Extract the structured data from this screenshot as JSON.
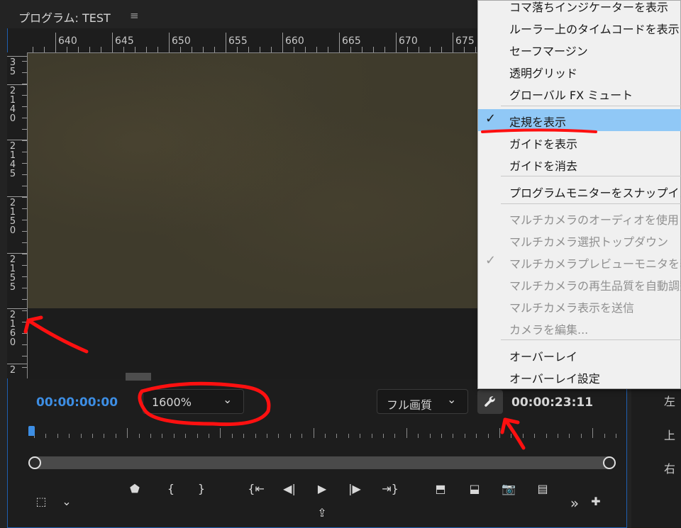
{
  "panel": {
    "title": "プログラム: TEST",
    "menu_icon": "≡"
  },
  "ruler": {
    "h_labels": [
      "640",
      "645",
      "650",
      "655",
      "660",
      "665",
      "670",
      "675"
    ],
    "v_labels": [
      "3 5",
      "2 1 4 0",
      "2 1 4 5",
      "2 1 5 0",
      "2 1 5 5",
      "2 1 6 0",
      "2"
    ]
  },
  "controls": {
    "timecode_current": "00:00:00:00",
    "zoom": "1600%",
    "quality": "フル画質",
    "timecode_duration": "00:00:23:11"
  },
  "menu": {
    "items": [
      {
        "label": "コマ落ちインジケーターを表示",
        "checked": false,
        "disabled": false
      },
      {
        "label": "ルーラー上のタイムコードを表示",
        "checked": false,
        "disabled": false
      },
      {
        "label": "セーフマージン",
        "checked": false,
        "disabled": false
      },
      {
        "label": "透明グリッド",
        "checked": false,
        "disabled": false
      },
      {
        "label": "グローバル FX ミュート",
        "checked": false,
        "disabled": false
      },
      {
        "label": "定規を表示",
        "checked": true,
        "disabled": false,
        "highlighted": true
      },
      {
        "label": "ガイドを表示",
        "checked": false,
        "disabled": false
      },
      {
        "label": "ガイドを消去",
        "checked": false,
        "disabled": false
      },
      {
        "label": "プログラムモニターをスナップイン",
        "checked": false,
        "disabled": false
      },
      {
        "label": "マルチカメラのオーディオを使用",
        "checked": false,
        "disabled": true
      },
      {
        "label": "マルチカメラ選択トップダウン",
        "checked": false,
        "disabled": true
      },
      {
        "label": "マルチカメラプレビューモニタを表示",
        "checked": true,
        "disabled": true
      },
      {
        "label": "マルチカメラの再生品質を自動調整",
        "checked": false,
        "disabled": true
      },
      {
        "label": "マルチカメラ表示を送信",
        "checked": false,
        "disabled": true
      },
      {
        "label": "カメラを編集...",
        "checked": false,
        "disabled": true
      },
      {
        "label": "オーバーレイ",
        "checked": false,
        "disabled": false
      },
      {
        "label": "オーバーレイ設定",
        "checked": false,
        "disabled": false
      }
    ],
    "check_glyph": "✓"
  },
  "right_panel": {
    "labels": [
      "左",
      "上",
      "右"
    ]
  },
  "icons": {
    "chevron": "⌄",
    "marker": "⬟",
    "mark_in": "{",
    "mark_out": "}",
    "goto_in": "{⇤",
    "step_back": "◀|",
    "play": "▶",
    "step_fwd": "|▶",
    "goto_out": "⇥}",
    "lift": "⬒",
    "extract": "⬓",
    "camera": "📷",
    "compare": "▤",
    "more": "»",
    "add": "✚",
    "export": "⇪",
    "safe_margin": "⬚"
  },
  "colors": {
    "accent": "#3d8ee4",
    "highlight": "#90c8f6",
    "annotation": "#ff1010"
  }
}
